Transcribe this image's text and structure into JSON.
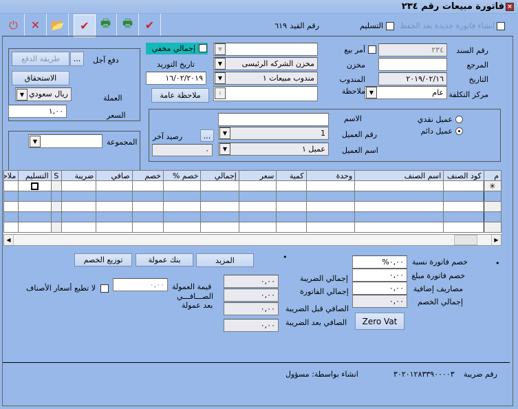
{
  "window": {
    "title": "فاتورة مبيعات رقم ٢٣٤",
    "close_icon": "close-icon"
  },
  "toolbar": {
    "buttons": [
      {
        "name": "exit-button",
        "icon": "power-icon",
        "glyph": "⏻",
        "color": "#d9462a"
      },
      {
        "name": "delete-button",
        "icon": "delete-x-icon",
        "glyph": "✕",
        "color": "#d0202a"
      },
      {
        "name": "open-button",
        "icon": "folder-open-icon",
        "glyph": "📂",
        "color": "#e6b84a"
      },
      {
        "name": "save-approve-button",
        "icon": "save-check-icon",
        "glyph": "✔",
        "color": "#d0202a"
      },
      {
        "name": "print-button",
        "icon": "print-green-icon",
        "glyph": "🖶",
        "color": "#2a8a2a"
      },
      {
        "name": "print-preview-button",
        "icon": "print-preview-icon",
        "glyph": "🖶",
        "color": "#2a8a2a"
      },
      {
        "name": "save-close-button",
        "icon": "save-check-icon",
        "glyph": "✔",
        "color": "#d0202a"
      }
    ]
  },
  "top": {
    "new_after_save_label": "إنشاء فاتورة جديدة بعد الحفظ",
    "delivery_label": "التسليم",
    "entry_no_label": "رقم القيد",
    "entry_no_value": "٦١٩"
  },
  "header": {
    "doc_no_label": "رقم السند",
    "doc_no_value": "٢٣٤",
    "sale_order_label": "أمر بيع",
    "reference_label": "المرجع",
    "reference_value": "",
    "date_label": "التاريخ",
    "date_value": "٢٠١٩/٠٢/١٦",
    "cost_center_label": "مركز التكلفة",
    "cost_center_value": "عام",
    "warehouse_label": "مخزن",
    "warehouse_value": "مخزن الشركه الرئيسى",
    "rep_label": "المندوب",
    "rep_value": "مندوب مبيعات ١",
    "note_label": "ملاحظة",
    "note_value": "",
    "top_combo_value": "",
    "hidden_total_label": "إجمالي مخفي",
    "supply_date_label": "تاريخ التوريد",
    "supply_date_value": "١٦/٠٢/٢٠١٩",
    "general_note_button": "ملاحظة عامة"
  },
  "payment": {
    "deferred_label": "دفع آجل",
    "payment_method_button": "طريقة الدفع",
    "ellipsis": "...",
    "due_button": "الاستحقاق",
    "currency_label": "العملة",
    "currency_value": "ريال سعودي",
    "rate_label": "السعر",
    "rate_value": "١,٠٠",
    "group_label": "المجموعة",
    "group_value": ""
  },
  "customer": {
    "cash_customer_label": "عميل نقدي",
    "regular_customer_label": "عميل دائم",
    "selected": "regular",
    "name_label": "الاسم",
    "name_value": "",
    "customer_no_label": "رقم العميل",
    "customer_no_value": "1",
    "customer_name_label": "اسم العميل",
    "customer_name_value": "عميل ١",
    "other_balance_label": "رصيد آخر",
    "other_balance_value": "٠",
    "ellipsis": "..."
  },
  "grid": {
    "columns": [
      "م",
      "كود الصنف",
      "اسم الصنف",
      "وحدة",
      "كمية",
      "سعر",
      "إجمالي",
      "خصم %",
      "خصم",
      "صافي",
      "ضريبة",
      "S",
      "التسليم",
      "ملاحظة"
    ],
    "new_row_marker": "✳",
    "rows": 5
  },
  "totals": {
    "more_button": "المزيد",
    "commission_bank_button": "بنك عمولة",
    "distribute_discount_button": "توزيع الخصم",
    "dot": "•",
    "invoice_discount_pct_label": "خصم فاتورة نسبة",
    "invoice_discount_pct_value": "٠,٠٠%",
    "invoice_discount_amt_label": "خصم فاتورة مبلغ",
    "invoice_discount_amt_value": "٠,٠٠",
    "extra_expenses_label": "مصاريف إضافية",
    "extra_expenses_value": "٠,٠٠",
    "total_discount_label": "إجمالي الخصم",
    "total_discount_value": "٠,٠٠",
    "zero_vat_button": "Zero Vat",
    "total_tax_label": "إجمالي الضريبة",
    "total_tax_value": "٠,٠٠",
    "invoice_total_label": "إجمالي الفاتورة",
    "invoice_total_value": "٠,٠٠",
    "net_before_tax_label": "الصافي قبل الضريبة",
    "net_before_tax_value": "٠,٠٠",
    "net_after_tax_label": "الصافي بعد الضريبة",
    "net_after_tax_value": "٠,٠٠",
    "commission_value_label": "قيمة العمولة",
    "commission_value": "٠,٠٠",
    "net_after_commission_label1": "الصـــافـــي",
    "net_after_commission_label2": "بعد عمولة",
    "no_print_prices_label": "لا تطبع أسعار الأصناف"
  },
  "footer": {
    "tax_no_label": "رقم ضريبة",
    "tax_no_value": "٣٠٢٠١٢٨٣٣٩٠٠٠٠٣",
    "created_by": "انشاء بواسطة: مسؤول"
  }
}
